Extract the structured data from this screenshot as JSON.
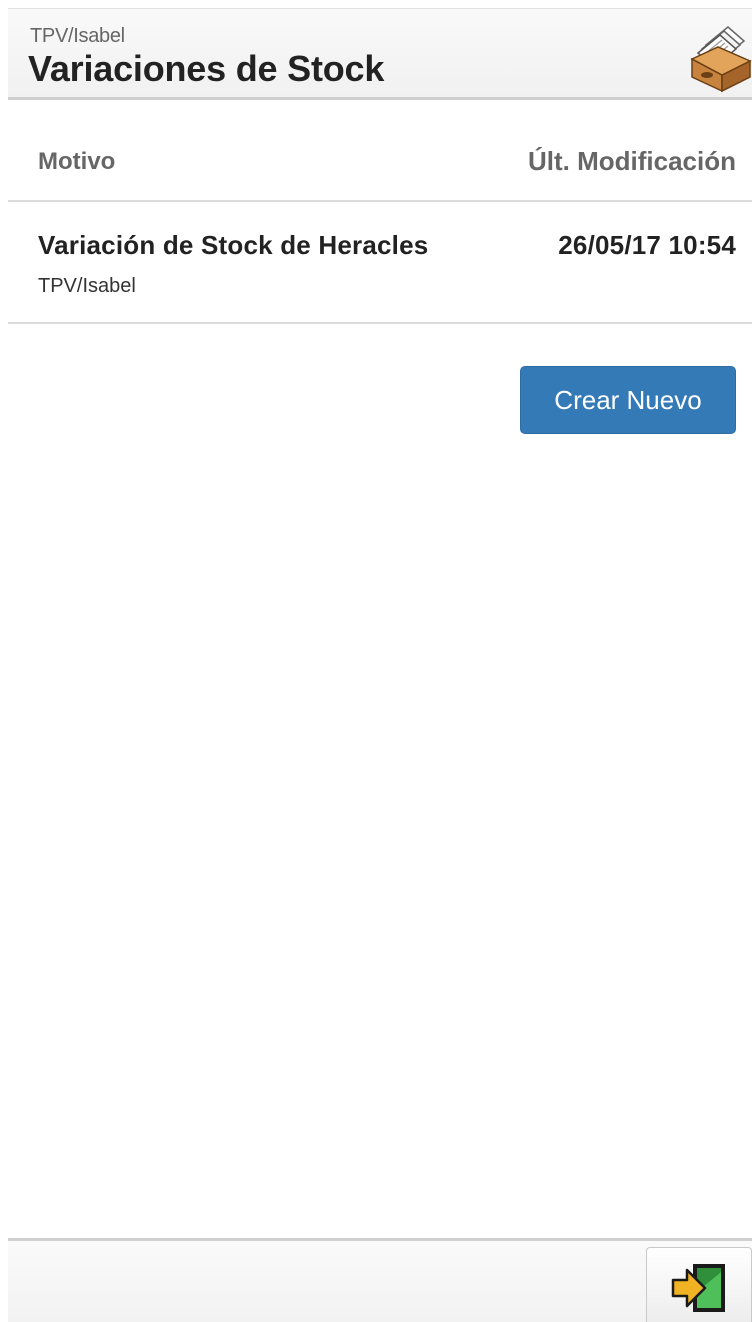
{
  "header": {
    "subtitle": "TPV/Isabel",
    "title": "Variaciones de Stock",
    "icon": "stock-box-icon"
  },
  "table": {
    "columns": {
      "motivo": "Motivo",
      "modificacion": "Últ. Modificación"
    },
    "rows": [
      {
        "title": "Variación de Stock de Heracles",
        "subtitle": "TPV/Isabel",
        "date": "26/05/17 10:54"
      }
    ]
  },
  "actions": {
    "create_label": "Crear Nuevo"
  },
  "footer": {
    "exit_icon": "exit-door-icon"
  },
  "colors": {
    "primary_button": "#337ab7",
    "exit_arrow": "#f0b323",
    "exit_door": "#2f8f3a"
  }
}
